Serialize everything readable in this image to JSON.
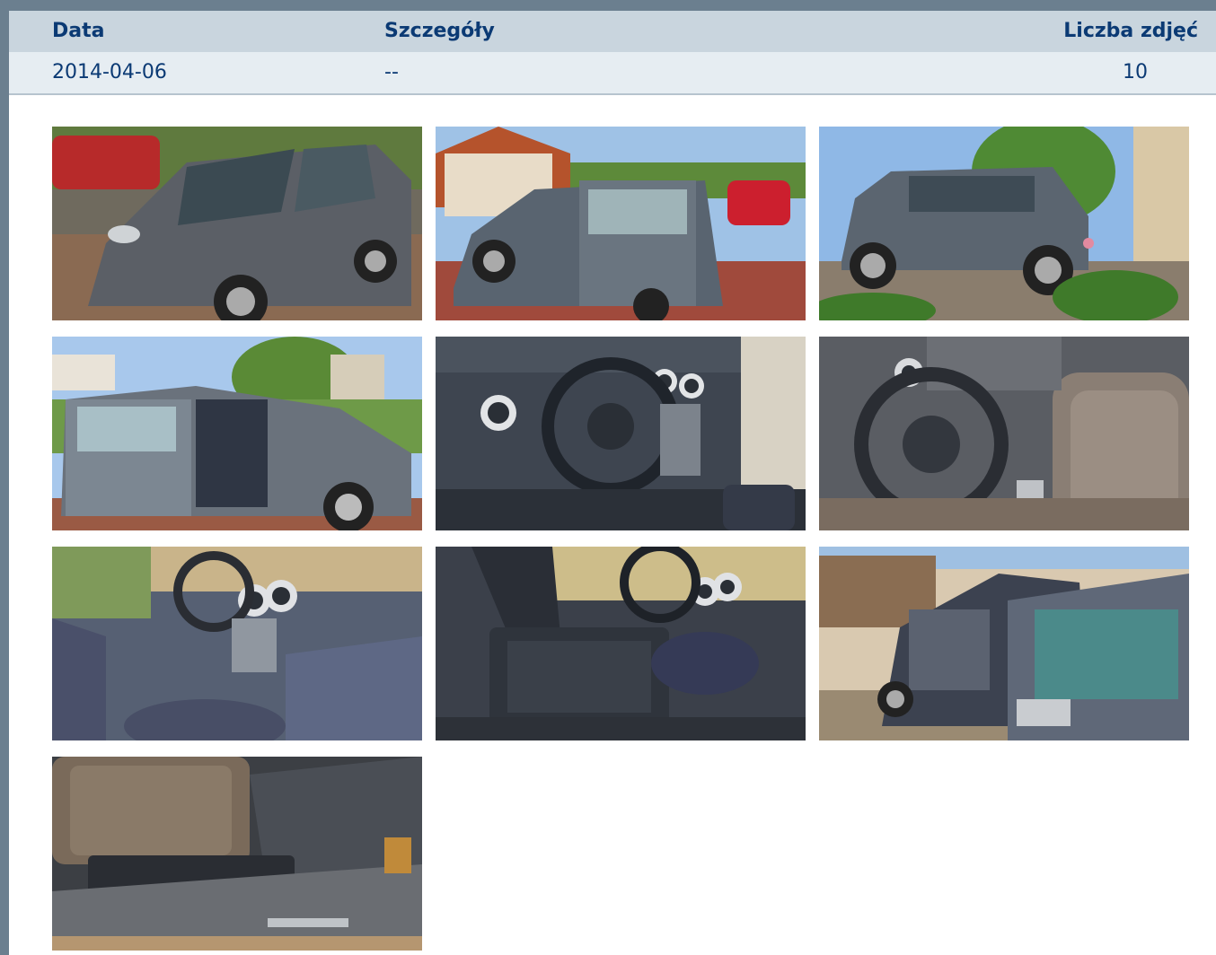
{
  "table": {
    "headers": {
      "date": "Data",
      "details": "Szczegóły",
      "photo_count": "Liczba zdjęć"
    },
    "row": {
      "date": "2014-04-06",
      "details": "--",
      "photo_count": "10"
    }
  },
  "gallery": {
    "photos": [
      {
        "subject": "car-front-three-quarter"
      },
      {
        "subject": "car-side-doors-open-driveway"
      },
      {
        "subject": "car-rear-three-quarter-garden"
      },
      {
        "subject": "car-side-open-door"
      },
      {
        "subject": "dashboard-steering-wheel"
      },
      {
        "subject": "steering-wheel-closeup"
      },
      {
        "subject": "interior-passenger-view"
      },
      {
        "subject": "interior-seats-console"
      },
      {
        "subject": "car-open-door-garage"
      },
      {
        "subject": "interior-door-sill-peugeot"
      }
    ]
  },
  "colors": {
    "frame": "#6b7f8f",
    "header_bg": "#c9d5de",
    "row_bg": "#e6edf2",
    "text": "#0b3a74"
  }
}
